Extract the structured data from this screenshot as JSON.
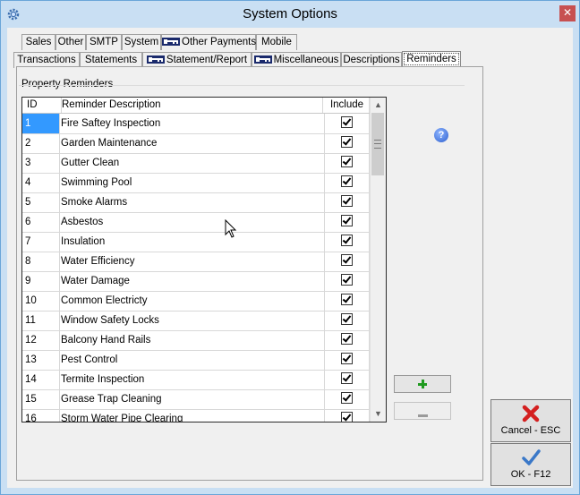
{
  "window": {
    "title": "System Options",
    "close_label": "✕"
  },
  "tabs_row1": [
    {
      "label": "Sales",
      "key": false
    },
    {
      "label": "Other",
      "key": false
    },
    {
      "label": "SMTP",
      "key": false
    },
    {
      "label": "System",
      "key": false
    },
    {
      "label": "Other Payments",
      "key": true
    },
    {
      "label": "Mobile",
      "key": false
    }
  ],
  "tabs_row2": [
    {
      "label": "Transactions",
      "key": false
    },
    {
      "label": "Statements",
      "key": false
    },
    {
      "label": "Statement/Report",
      "key": true
    },
    {
      "label": "Miscellaneous",
      "key": true
    },
    {
      "label": "Descriptions",
      "key": false
    },
    {
      "label": "Reminders",
      "key": false,
      "active": true
    }
  ],
  "group": {
    "label": "Property Reminders"
  },
  "grid": {
    "columns": [
      "ID",
      "Reminder Description",
      "Include"
    ],
    "rows": [
      {
        "id": "1",
        "desc": "Fire Saftey Inspection",
        "include": true
      },
      {
        "id": "2",
        "desc": "Garden Maintenance",
        "include": true
      },
      {
        "id": "3",
        "desc": "Gutter Clean",
        "include": true
      },
      {
        "id": "4",
        "desc": "Swimming Pool",
        "include": true
      },
      {
        "id": "5",
        "desc": "Smoke Alarms",
        "include": true
      },
      {
        "id": "6",
        "desc": "Asbestos",
        "include": true
      },
      {
        "id": "7",
        "desc": "Insulation",
        "include": true
      },
      {
        "id": "8",
        "desc": "Water Efficiency",
        "include": true
      },
      {
        "id": "9",
        "desc": "Water Damage",
        "include": true
      },
      {
        "id": "10",
        "desc": "Common Electricty",
        "include": true
      },
      {
        "id": "11",
        "desc": "Window Safety Locks",
        "include": true
      },
      {
        "id": "12",
        "desc": "Balcony Hand Rails",
        "include": true
      },
      {
        "id": "13",
        "desc": "Pest Control",
        "include": true
      },
      {
        "id": "14",
        "desc": "Termite Inspection",
        "include": true
      },
      {
        "id": "15",
        "desc": "Grease Trap Cleaning",
        "include": true
      },
      {
        "id": "16",
        "desc": "Storm Water Pipe Clearing",
        "include": true
      }
    ]
  },
  "buttons": {
    "help_glyph": "?",
    "cancel_label": "Cancel - ESC",
    "ok_label": "OK - F12"
  },
  "colors": {
    "selection": "#3399ff",
    "title_bar": "#c9dff3",
    "add_green": "#1f9a1f",
    "cancel_red": "#d42020",
    "ok_blue": "#3a78c8"
  }
}
